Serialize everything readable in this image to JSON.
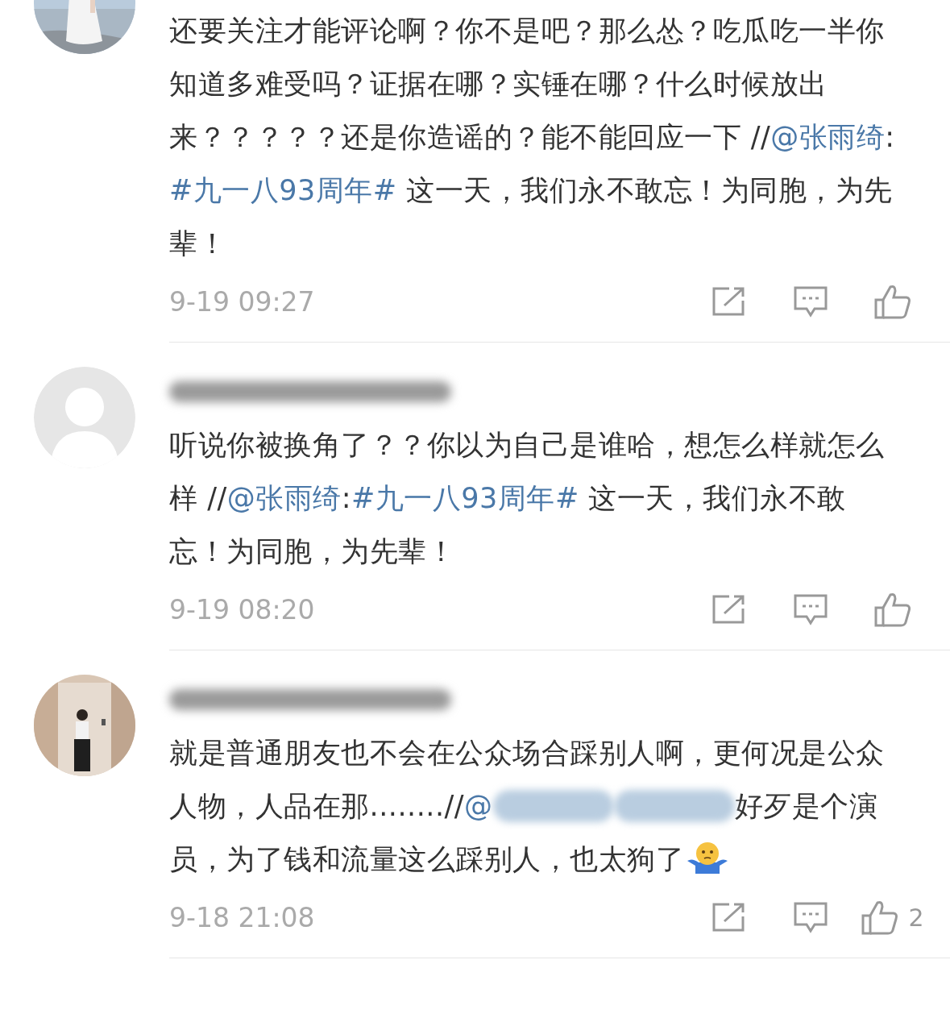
{
  "comments": [
    {
      "avatar": {
        "kind": "sea-photo"
      },
      "author_redacted": false,
      "content": [
        {
          "kind": "text",
          "text": "还要关注才能评论啊？你不是吧？那么怂？吃瓜吃一半你知道多难受吗？证据在哪？实锤在哪？什么时候放出来？？？？？还是你造谣的？能不能回应一下 //"
        },
        {
          "kind": "mention",
          "text": "@张雨绮"
        },
        {
          "kind": "text",
          "text": ":"
        },
        {
          "kind": "topic",
          "text": "#九一八93周年#"
        },
        {
          "kind": "text",
          "text": " 这一天，我们永不敢忘！为同胞，为先辈！"
        }
      ],
      "time": "9-19 09:27"
    },
    {
      "avatar": {
        "kind": "default"
      },
      "author_redacted": true,
      "content": [
        {
          "kind": "text",
          "text": "听说你被换角了？？你以为自己是谁哈，想怎么样就怎么样 //"
        },
        {
          "kind": "mention",
          "text": "@张雨绮"
        },
        {
          "kind": "text",
          "text": ":"
        },
        {
          "kind": "topic",
          "text": "#九一八93周年#"
        },
        {
          "kind": "text",
          "text": " 这一天，我们永不敢忘！为同胞，为先辈！"
        }
      ],
      "time": "9-19 08:20"
    },
    {
      "avatar": {
        "kind": "room-photo"
      },
      "author_redacted": true,
      "content": [
        {
          "kind": "text",
          "text": "就是普通朋友也不会在公众场合踩别人啊，更何况是公众人物，人品在那........//"
        },
        {
          "kind": "mention",
          "text": "@"
        },
        {
          "kind": "redacted"
        },
        {
          "kind": "redacted"
        },
        {
          "kind": "text",
          "text": "好歹是个演员，为了钱和流量这么踩别人，也太狗了"
        },
        {
          "kind": "emoji"
        }
      ],
      "time": "9-18 21:08",
      "likes": "2"
    }
  ]
}
